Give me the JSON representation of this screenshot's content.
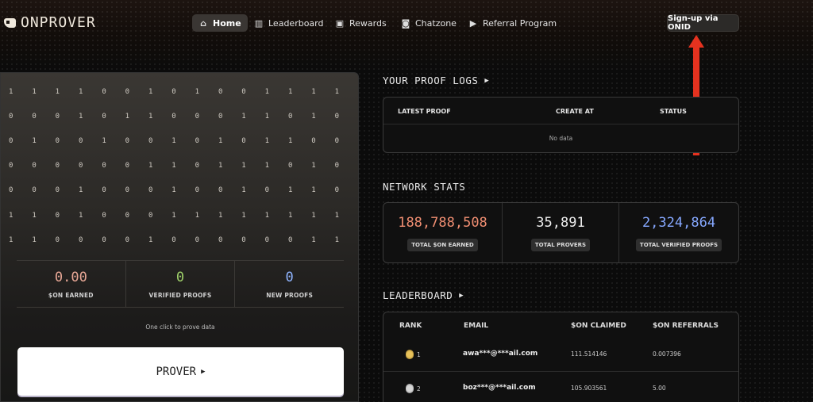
{
  "brand": {
    "name": "ONPROVER"
  },
  "nav": {
    "items": [
      {
        "label": "Home",
        "icon": "home-icon",
        "active": true
      },
      {
        "label": "Leaderboard",
        "icon": "leaderboard-icon"
      },
      {
        "label": "Rewards",
        "icon": "rewards-icon"
      },
      {
        "label": "Chatzone",
        "icon": "chat-icon"
      },
      {
        "label": "Referral Program",
        "icon": "referral-icon"
      }
    ],
    "signup_label": "Sign-up via ONID"
  },
  "prover_panel": {
    "bits": [
      [
        "1",
        "1",
        "1",
        "1",
        "0",
        "0",
        "1",
        "0",
        "1",
        "0",
        "0",
        "1",
        "1",
        "1",
        "1"
      ],
      [
        "0",
        "0",
        "0",
        "1",
        "0",
        "1",
        "1",
        "0",
        "0",
        "0",
        "1",
        "1",
        "0",
        "1",
        "0"
      ],
      [
        "0",
        "1",
        "0",
        "0",
        "1",
        "0",
        "0",
        "1",
        "0",
        "1",
        "0",
        "1",
        "1",
        "0",
        "0"
      ],
      [
        "0",
        "0",
        "0",
        "0",
        "0",
        "0",
        "1",
        "1",
        "0",
        "1",
        "1",
        "1",
        "0",
        "1",
        "0"
      ],
      [
        "0",
        "0",
        "0",
        "1",
        "0",
        "0",
        "0",
        "1",
        "0",
        "0",
        "1",
        "0",
        "1",
        "1",
        "0"
      ],
      [
        "1",
        "1",
        "0",
        "1",
        "0",
        "0",
        "0",
        "1",
        "1",
        "1",
        "1",
        "1",
        "1",
        "1",
        "1"
      ],
      [
        "1",
        "1",
        "0",
        "0",
        "0",
        "0",
        "1",
        "0",
        "0",
        "0",
        "0",
        "0",
        "0",
        "1",
        "1"
      ]
    ],
    "stats": [
      {
        "value": "0.00",
        "label": "$ON EARNED",
        "color": "#e8a796"
      },
      {
        "value": "0",
        "label": "VERIFIED PROOFS",
        "color": "#9fd06a"
      },
      {
        "value": "0",
        "label": "NEW PROOFS",
        "color": "#8fb4ff"
      }
    ],
    "hint": "One click to prove data",
    "button_label": "PROVER"
  },
  "proof_logs": {
    "title": "YOUR PROOF LOGS",
    "columns": [
      "LATEST PROOF",
      "CREATE AT",
      "STATUS"
    ],
    "empty_text": "No data"
  },
  "network_stats": {
    "title": "NETWORK STATS",
    "items": [
      {
        "value": "188,788,508",
        "label": "TOTAL $ON EARNED",
        "color": "#f08e72"
      },
      {
        "value": "35,891",
        "label": "TOTAL PROVERS",
        "color": "#ededed"
      },
      {
        "value": "2,324,864",
        "label": "TOTAL VERIFIED PROOFS",
        "color": "#86a8ff"
      }
    ]
  },
  "leaderboard": {
    "title": "LEADERBOARD",
    "columns": [
      "RANK",
      "EMAIL",
      "$ON CLAIMED",
      "$ON REFERRALS"
    ],
    "rows": [
      {
        "rank": "1",
        "medal": "gold-medal-icon",
        "email": "awa***@***ail.com",
        "claimed": "111.514146",
        "referrals": "0.007396"
      },
      {
        "rank": "2",
        "medal": "silver-medal-icon",
        "email": "boz***@***ail.com",
        "claimed": "105.903561",
        "referrals": "5.00"
      }
    ]
  },
  "colors": {
    "background": "#0b0b0b",
    "annotation_arrow": "#e5321f"
  }
}
